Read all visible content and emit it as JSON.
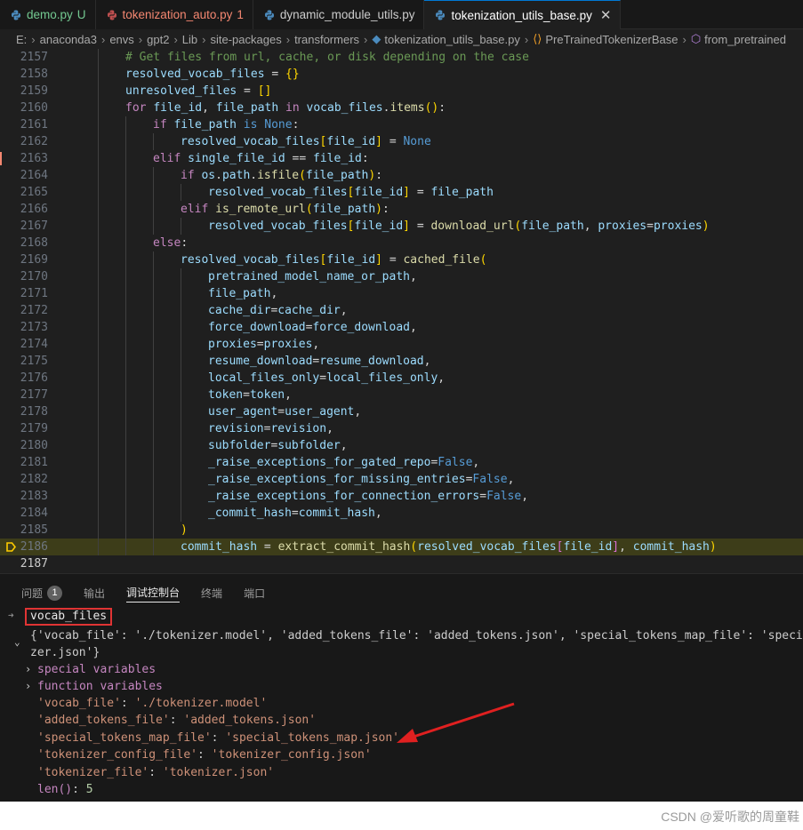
{
  "tabs": [
    {
      "name": "demo.py",
      "suffix": "U",
      "state": "mod"
    },
    {
      "name": "tokenization_auto.py",
      "suffix": "1",
      "state": "err"
    },
    {
      "name": "dynamic_module_utils.py",
      "suffix": "",
      "state": ""
    },
    {
      "name": "tokenization_utils_base.py",
      "suffix": "",
      "state": "active"
    }
  ],
  "breadcrumb": [
    "E:",
    "anaconda3",
    "envs",
    "gpt2",
    "Lib",
    "site-packages",
    "transformers",
    "tokenization_utils_base.py",
    "PreTrainedTokenizerBase",
    "from_pretrained"
  ],
  "code_lines": [
    {
      "n": "2157",
      "i": 2,
      "t": [
        [
          "cm",
          "# Get files from url, cache, or disk depending on the case"
        ]
      ]
    },
    {
      "n": "2158",
      "i": 2,
      "t": [
        [
          "var",
          "resolved_vocab_files"
        ],
        [
          "op",
          " = "
        ],
        [
          "br1",
          "{}"
        ]
      ]
    },
    {
      "n": "2159",
      "i": 2,
      "t": [
        [
          "var",
          "unresolved_files"
        ],
        [
          "op",
          " = "
        ],
        [
          "br1",
          "[]"
        ]
      ]
    },
    {
      "n": "2160",
      "i": 2,
      "t": [
        [
          "kw",
          "for"
        ],
        [
          "op",
          " "
        ],
        [
          "var",
          "file_id"
        ],
        [
          "op",
          ", "
        ],
        [
          "var",
          "file_path"
        ],
        [
          "op",
          " "
        ],
        [
          "kw",
          "in"
        ],
        [
          "op",
          " "
        ],
        [
          "var",
          "vocab_files"
        ],
        [
          "op",
          "."
        ],
        [
          "fn",
          "items"
        ],
        [
          "br1",
          "()"
        ],
        [
          "op",
          ":"
        ]
      ]
    },
    {
      "n": "2161",
      "i": 3,
      "t": [
        [
          "kw",
          "if"
        ],
        [
          "op",
          " "
        ],
        [
          "var",
          "file_path"
        ],
        [
          "op",
          " "
        ],
        [
          "kb",
          "is"
        ],
        [
          "op",
          " "
        ],
        [
          "kb",
          "None"
        ],
        [
          "op",
          ":"
        ]
      ]
    },
    {
      "n": "2162",
      "i": 4,
      "t": [
        [
          "var",
          "resolved_vocab_files"
        ],
        [
          "br1",
          "["
        ],
        [
          "var",
          "file_id"
        ],
        [
          "br1",
          "]"
        ],
        [
          "op",
          " = "
        ],
        [
          "kb",
          "None"
        ]
      ]
    },
    {
      "n": "2163",
      "i": 3,
      "t": [
        [
          "kw",
          "elif"
        ],
        [
          "op",
          " "
        ],
        [
          "var",
          "single_file_id"
        ],
        [
          "op",
          " == "
        ],
        [
          "var",
          "file_id"
        ],
        [
          "op",
          ":"
        ]
      ]
    },
    {
      "n": "2164",
      "i": 4,
      "t": [
        [
          "kw",
          "if"
        ],
        [
          "op",
          " "
        ],
        [
          "var",
          "os"
        ],
        [
          "op",
          "."
        ],
        [
          "var",
          "path"
        ],
        [
          "op",
          "."
        ],
        [
          "fn",
          "isfile"
        ],
        [
          "br1",
          "("
        ],
        [
          "var",
          "file_path"
        ],
        [
          "br1",
          ")"
        ],
        [
          "op",
          ":"
        ]
      ]
    },
    {
      "n": "2165",
      "i": 5,
      "t": [
        [
          "var",
          "resolved_vocab_files"
        ],
        [
          "br1",
          "["
        ],
        [
          "var",
          "file_id"
        ],
        [
          "br1",
          "]"
        ],
        [
          "op",
          " = "
        ],
        [
          "var",
          "file_path"
        ]
      ]
    },
    {
      "n": "2166",
      "i": 4,
      "t": [
        [
          "kw",
          "elif"
        ],
        [
          "op",
          " "
        ],
        [
          "fn",
          "is_remote_url"
        ],
        [
          "br1",
          "("
        ],
        [
          "var",
          "file_path"
        ],
        [
          "br1",
          ")"
        ],
        [
          "op",
          ":"
        ]
      ]
    },
    {
      "n": "2167",
      "i": 5,
      "t": [
        [
          "var",
          "resolved_vocab_files"
        ],
        [
          "br1",
          "["
        ],
        [
          "var",
          "file_id"
        ],
        [
          "br1",
          "]"
        ],
        [
          "op",
          " = "
        ],
        [
          "fn",
          "download_url"
        ],
        [
          "br1",
          "("
        ],
        [
          "var",
          "file_path"
        ],
        [
          "op",
          ", "
        ],
        [
          "var",
          "proxies"
        ],
        [
          "op",
          "="
        ],
        [
          "var",
          "proxies"
        ],
        [
          "br1",
          ")"
        ]
      ]
    },
    {
      "n": "2168",
      "i": 3,
      "t": [
        [
          "kw",
          "else"
        ],
        [
          "op",
          ":"
        ]
      ]
    },
    {
      "n": "2169",
      "i": 4,
      "t": [
        [
          "var",
          "resolved_vocab_files"
        ],
        [
          "br1",
          "["
        ],
        [
          "var",
          "file_id"
        ],
        [
          "br1",
          "]"
        ],
        [
          "op",
          " = "
        ],
        [
          "fn",
          "cached_file"
        ],
        [
          "br1",
          "("
        ]
      ]
    },
    {
      "n": "2170",
      "i": 5,
      "t": [
        [
          "var",
          "pretrained_model_name_or_path"
        ],
        [
          "op",
          ","
        ]
      ]
    },
    {
      "n": "2171",
      "i": 5,
      "t": [
        [
          "var",
          "file_path"
        ],
        [
          "op",
          ","
        ]
      ]
    },
    {
      "n": "2172",
      "i": 5,
      "t": [
        [
          "var",
          "cache_dir"
        ],
        [
          "op",
          "="
        ],
        [
          "var",
          "cache_dir"
        ],
        [
          "op",
          ","
        ]
      ]
    },
    {
      "n": "2173",
      "i": 5,
      "t": [
        [
          "var",
          "force_download"
        ],
        [
          "op",
          "="
        ],
        [
          "var",
          "force_download"
        ],
        [
          "op",
          ","
        ]
      ]
    },
    {
      "n": "2174",
      "i": 5,
      "t": [
        [
          "var",
          "proxies"
        ],
        [
          "op",
          "="
        ],
        [
          "var",
          "proxies"
        ],
        [
          "op",
          ","
        ]
      ]
    },
    {
      "n": "2175",
      "i": 5,
      "t": [
        [
          "var",
          "resume_download"
        ],
        [
          "op",
          "="
        ],
        [
          "var",
          "resume_download"
        ],
        [
          "op",
          ","
        ]
      ]
    },
    {
      "n": "2176",
      "i": 5,
      "t": [
        [
          "var",
          "local_files_only"
        ],
        [
          "op",
          "="
        ],
        [
          "var",
          "local_files_only"
        ],
        [
          "op",
          ","
        ]
      ]
    },
    {
      "n": "2177",
      "i": 5,
      "t": [
        [
          "var",
          "token"
        ],
        [
          "op",
          "="
        ],
        [
          "var",
          "token"
        ],
        [
          "op",
          ","
        ]
      ]
    },
    {
      "n": "2178",
      "i": 5,
      "t": [
        [
          "var",
          "user_agent"
        ],
        [
          "op",
          "="
        ],
        [
          "var",
          "user_agent"
        ],
        [
          "op",
          ","
        ]
      ]
    },
    {
      "n": "2179",
      "i": 5,
      "t": [
        [
          "var",
          "revision"
        ],
        [
          "op",
          "="
        ],
        [
          "var",
          "revision"
        ],
        [
          "op",
          ","
        ]
      ]
    },
    {
      "n": "2180",
      "i": 5,
      "t": [
        [
          "var",
          "subfolder"
        ],
        [
          "op",
          "="
        ],
        [
          "var",
          "subfolder"
        ],
        [
          "op",
          ","
        ]
      ]
    },
    {
      "n": "2181",
      "i": 5,
      "t": [
        [
          "var",
          "_raise_exceptions_for_gated_repo"
        ],
        [
          "op",
          "="
        ],
        [
          "kb",
          "False"
        ],
        [
          "op",
          ","
        ]
      ]
    },
    {
      "n": "2182",
      "i": 5,
      "t": [
        [
          "var",
          "_raise_exceptions_for_missing_entries"
        ],
        [
          "op",
          "="
        ],
        [
          "kb",
          "False"
        ],
        [
          "op",
          ","
        ]
      ]
    },
    {
      "n": "2183",
      "i": 5,
      "t": [
        [
          "var",
          "_raise_exceptions_for_connection_errors"
        ],
        [
          "op",
          "="
        ],
        [
          "kb",
          "False"
        ],
        [
          "op",
          ","
        ]
      ]
    },
    {
      "n": "2184",
      "i": 5,
      "t": [
        [
          "var",
          "_commit_hash"
        ],
        [
          "op",
          "="
        ],
        [
          "var",
          "commit_hash"
        ],
        [
          "op",
          ","
        ]
      ]
    },
    {
      "n": "2185",
      "i": 4,
      "t": [
        [
          "br1",
          ")"
        ]
      ]
    },
    {
      "n": "2186",
      "i": 4,
      "hl": true,
      "bp": true,
      "t": [
        [
          "var",
          "commit_hash"
        ],
        [
          "op",
          " = "
        ],
        [
          "fn",
          "extract_commit_hash"
        ],
        [
          "br1",
          "("
        ],
        [
          "var",
          "resolved_vocab_files"
        ],
        [
          "br2",
          "["
        ],
        [
          "var",
          "file_id"
        ],
        [
          "br2",
          "]"
        ],
        [
          "op",
          ", "
        ],
        [
          "var",
          "commit_hash"
        ],
        [
          "br1",
          ")"
        ]
      ]
    },
    {
      "n": "2187",
      "i": 0,
      "cur": true,
      "t": []
    }
  ],
  "panel": {
    "tabs": [
      {
        "label": "问题",
        "badge": "1"
      },
      {
        "label": "输出"
      },
      {
        "label": "调试控制台",
        "active": true
      },
      {
        "label": "终端"
      },
      {
        "label": "端口"
      }
    ],
    "input": "vocab_files",
    "result_line1": "{'vocab_file': './tokenizer.model', 'added_tokens_file': 'added_tokens.json', 'special_tokens_map_file': 'special",
    "result_line2": "zer.json'}",
    "groups": [
      "special variables",
      "function variables"
    ],
    "entries": [
      {
        "k": "'vocab_file'",
        "v": "'./tokenizer.model'"
      },
      {
        "k": "'added_tokens_file'",
        "v": "'added_tokens.json'"
      },
      {
        "k": "'special_tokens_map_file'",
        "v": "'special_tokens_map.json'"
      },
      {
        "k": "'tokenizer_config_file'",
        "v": "'tokenizer_config.json'"
      },
      {
        "k": "'tokenizer_file'",
        "v": "'tokenizer.json'"
      }
    ],
    "len_label": "len()",
    "len_value": "5"
  },
  "watermark": "CSDN @爱听歌的周童鞋"
}
